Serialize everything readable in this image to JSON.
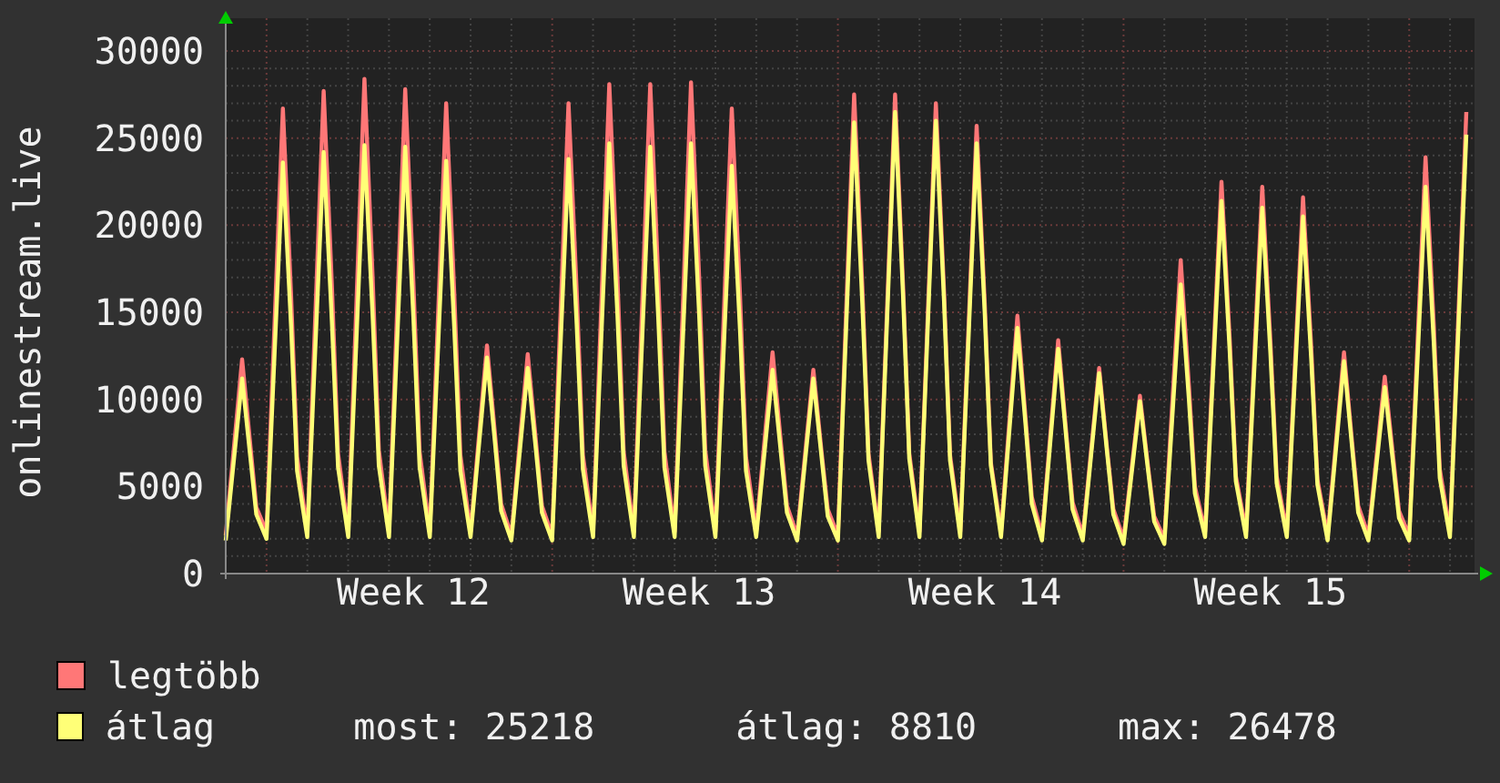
{
  "chart": {
    "chart_data": {
      "type": "line",
      "ylabel": "onlinestream.live",
      "grid": true,
      "ylim": [
        0,
        30000
      ],
      "yticks": [
        0,
        5000,
        10000,
        15000,
        20000,
        25000,
        30000
      ],
      "categories": [
        null,
        null,
        null,
        null,
        null,
        null,
        null,
        null,
        null,
        null,
        null,
        null,
        null,
        null,
        null,
        null,
        null,
        null,
        "Week 12",
        null,
        null,
        null,
        null,
        null,
        null,
        null,
        null,
        null,
        null,
        null,
        null,
        null,
        null,
        null,
        null,
        null,
        null,
        null,
        null,
        null,
        null,
        null,
        null,
        null,
        null,
        null,
        "Week 13",
        null,
        null,
        null,
        null,
        null,
        null,
        null,
        null,
        null,
        null,
        null,
        null,
        null,
        null,
        null,
        null,
        null,
        null,
        null,
        null,
        null,
        null,
        null,
        null,
        null,
        null,
        null,
        "Week 14",
        null,
        null,
        null,
        null,
        null,
        null,
        null,
        null,
        null,
        null,
        null,
        null,
        null,
        null,
        null,
        null,
        null,
        null,
        null,
        null,
        null,
        null,
        null,
        null,
        null,
        null,
        null,
        "Week 15",
        null,
        null,
        null,
        null,
        null,
        null,
        null,
        null,
        null,
        null,
        null,
        null,
        null,
        null,
        null,
        null,
        null,
        null,
        null
      ],
      "series": [
        {
          "name": "legtöbb",
          "color": "#ff7777",
          "values": [
            2200,
            12300,
            7400,
            3800,
            2400,
            26700,
            16000,
            6700,
            2400,
            27700,
            16600,
            6900,
            2400,
            28400,
            17000,
            7100,
            2400,
            27800,
            16700,
            7000,
            2400,
            27000,
            16200,
            6800,
            2400,
            13100,
            7900,
            4000,
            2200,
            12600,
            7600,
            3900,
            2200,
            27000,
            16200,
            6800,
            2400,
            28100,
            16900,
            7000,
            2400,
            28100,
            16900,
            7000,
            2400,
            28200,
            16900,
            7100,
            2400,
            26700,
            16000,
            6700,
            2400,
            12700,
            7600,
            3900,
            2200,
            11700,
            7000,
            3700,
            2200,
            27500,
            16500,
            6900,
            2400,
            27500,
            16500,
            6900,
            2400,
            27000,
            16200,
            6800,
            2400,
            25700,
            15400,
            6400,
            2400,
            14800,
            8900,
            4400,
            2200,
            13400,
            8000,
            4100,
            2200,
            11800,
            7100,
            3700,
            2000,
            10200,
            6100,
            3300,
            2000,
            18000,
            10800,
            5000,
            2400,
            22500,
            13500,
            5600,
            2400,
            22200,
            13300,
            5600,
            2400,
            21600,
            13000,
            5400,
            2200,
            12700,
            7600,
            3900,
            2200,
            11300,
            6800,
            3600,
            2200,
            23900,
            14300,
            6000,
            2400,
            26500
          ]
        },
        {
          "name": "átlag",
          "color": "#ffff77",
          "values": [
            1900,
            11200,
            6700,
            3400,
            2000,
            23600,
            14200,
            5900,
            2100,
            24200,
            14500,
            6100,
            2100,
            24600,
            14800,
            6200,
            2100,
            24500,
            14700,
            6100,
            2100,
            23700,
            14200,
            5900,
            2100,
            12400,
            7400,
            3600,
            1900,
            11800,
            7100,
            3500,
            1900,
            23800,
            14300,
            6000,
            2100,
            24700,
            14800,
            6200,
            2100,
            24500,
            14700,
            6100,
            2100,
            24700,
            14800,
            6200,
            2100,
            23400,
            14000,
            5900,
            2100,
            11700,
            7000,
            3500,
            1900,
            11200,
            6700,
            3300,
            1900,
            25900,
            15500,
            6500,
            2100,
            26500,
            15900,
            6600,
            2100,
            26000,
            15600,
            6500,
            2100,
            24700,
            14800,
            6200,
            2100,
            14100,
            8500,
            4000,
            1900,
            12900,
            7700,
            3700,
            1900,
            11500,
            6900,
            3400,
            1700,
            9900,
            5900,
            3000,
            1700,
            16600,
            10000,
            4600,
            2100,
            21400,
            12800,
            5300,
            2100,
            21000,
            12600,
            5200,
            2100,
            20500,
            12300,
            5100,
            1900,
            12200,
            7300,
            3500,
            1900,
            10700,
            6400,
            3200,
            1900,
            22200,
            13300,
            5500,
            2100,
            25200
          ]
        }
      ]
    }
  },
  "legend_stats": [
    "most: 25218",
    "átlag: 8810",
    "max: 26478"
  ]
}
